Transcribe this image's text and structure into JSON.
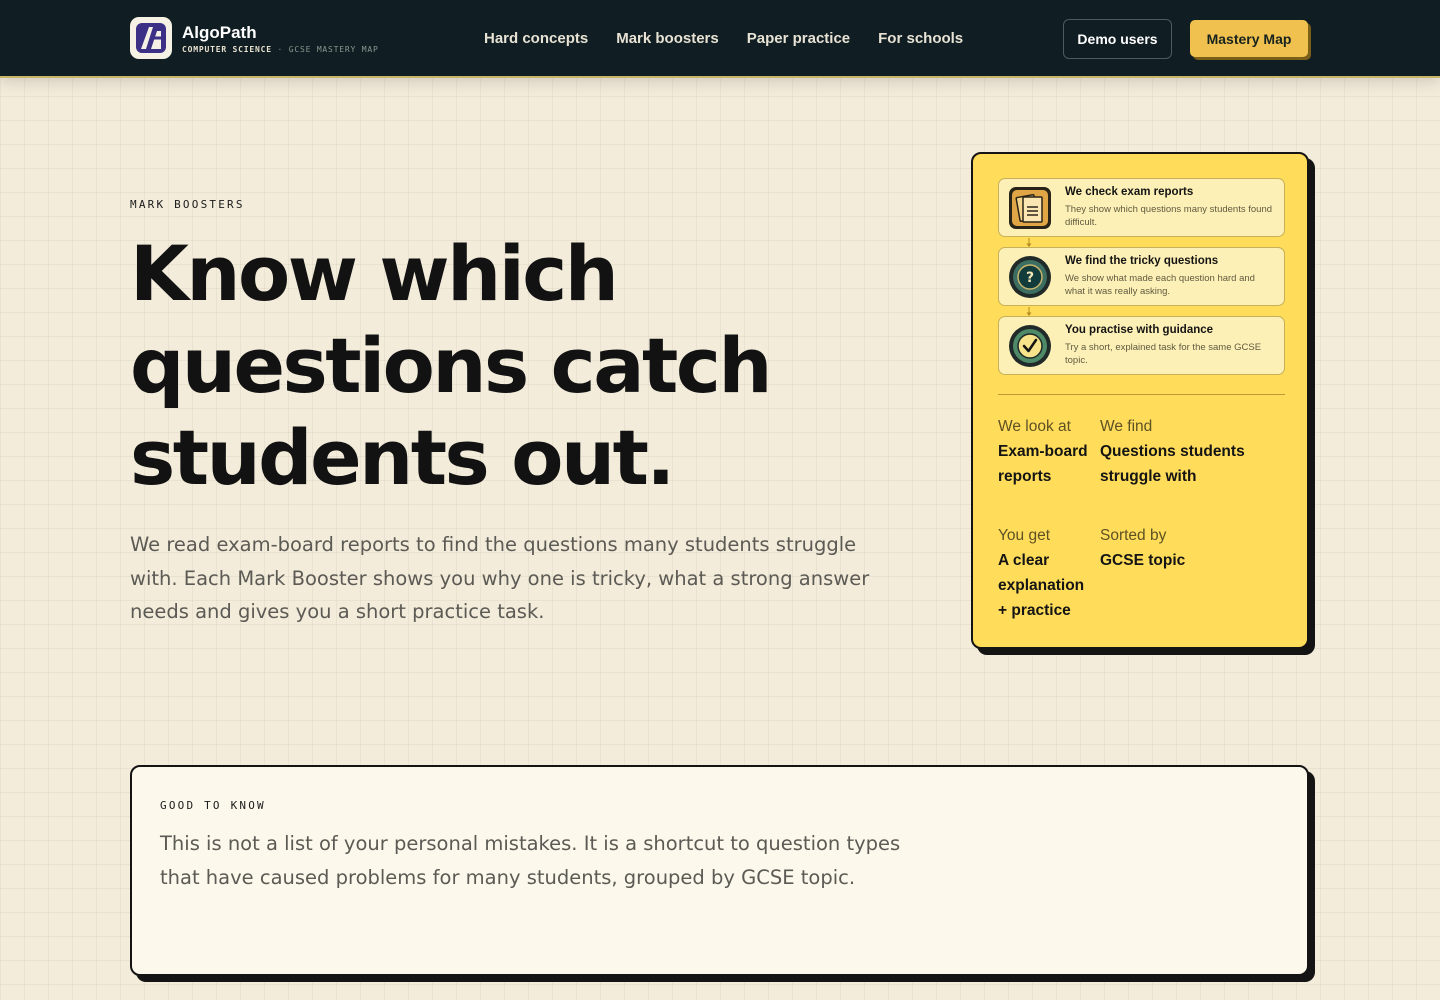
{
  "navbar": {
    "brand_name": "AlgoPath",
    "brand_sub_primary": "COMPUTER SCIENCE",
    "brand_sub_secondary": "· GCSE MASTERY MAP",
    "links": [
      "Hard concepts",
      "Mark boosters",
      "Paper practice",
      "For schools"
    ],
    "demo_label": "Demo users",
    "mastery_label": "Mastery Map"
  },
  "hero": {
    "eyebrow": "MARK BOOSTERS",
    "title_lines": [
      "Know which",
      "questions catch",
      "students out."
    ],
    "description": "We read exam-board reports to find the questions many students struggle with. Each Mark Booster shows you why one is tricky, what a strong answer needs and gives you a short practice task."
  },
  "process_card": {
    "steps": [
      {
        "icon": "report-icon",
        "title": "We check exam reports",
        "desc": "They show which questions many students found difficult."
      },
      {
        "icon": "question-icon",
        "title": "We find the tricky questions",
        "desc": "We show what made each question hard and what it was really asking."
      },
      {
        "icon": "check-icon",
        "title": "You practise with guidance",
        "desc": "Try a short, explained task for the same GCSE topic."
      }
    ],
    "stats": [
      {
        "label": "We look at",
        "value": "Exam-board reports"
      },
      {
        "label": "We find",
        "value": "Questions students struggle with"
      },
      {
        "label": "You get",
        "value": "A clear explanation + practice"
      },
      {
        "label": "Sorted by",
        "value": "GCSE topic"
      }
    ]
  },
  "good_to_know": {
    "label": "GOOD TO KNOW",
    "text": "This is not a list of your personal mistakes. It is a shortcut to question types that have caused problems for many students, grouped by GCSE topic."
  },
  "colors": {
    "navbar_bg": "#101d22",
    "accent_yellow": "#ffdc59",
    "button_gold": "#f0c14e",
    "page_bg": "#f3ecdb"
  }
}
